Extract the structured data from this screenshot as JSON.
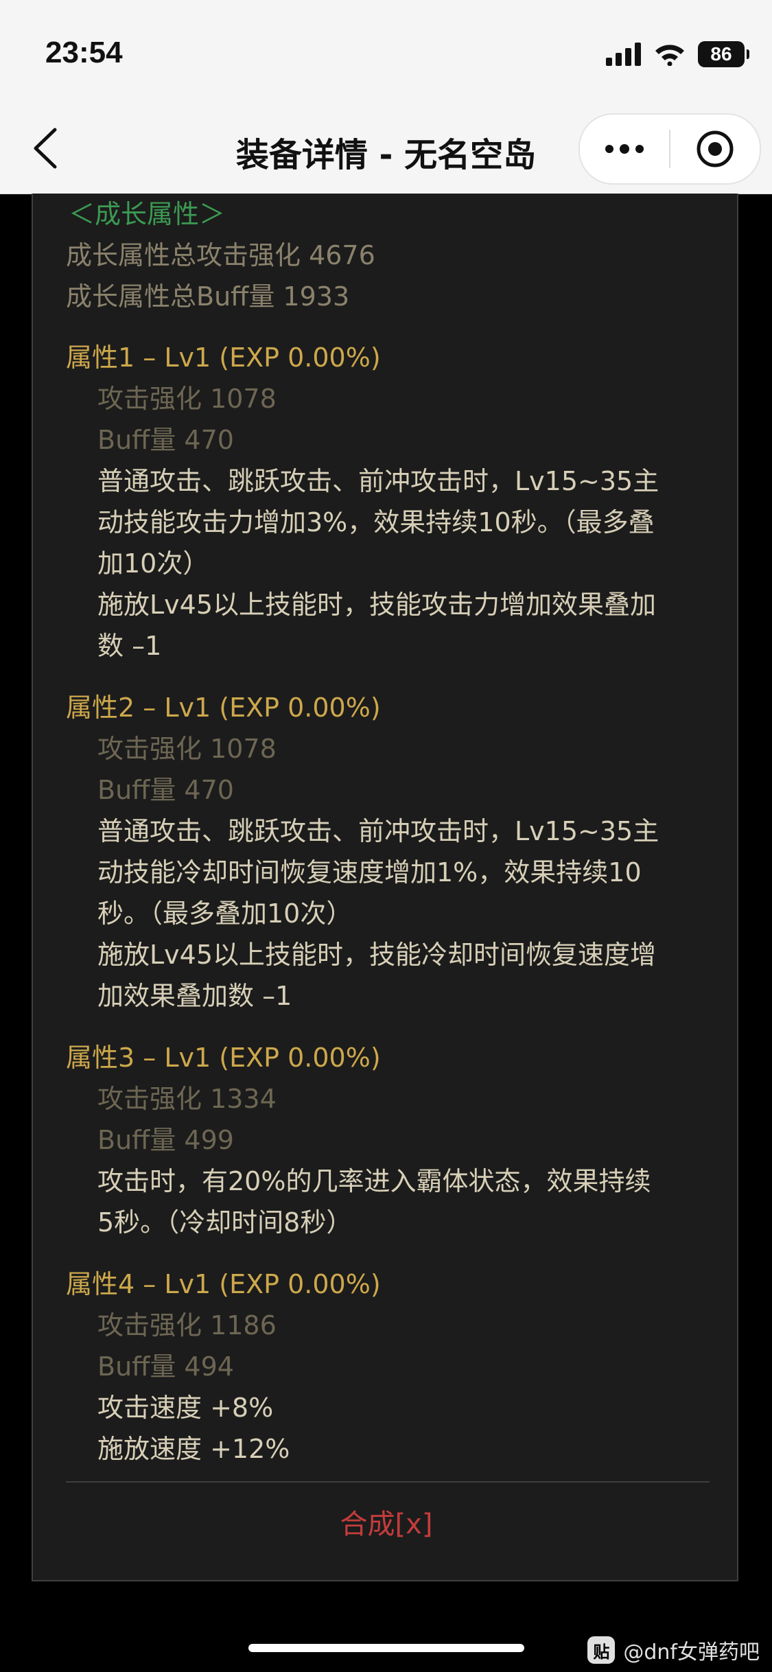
{
  "status_bar": {
    "time": "23:54",
    "battery": "86"
  },
  "nav": {
    "title": "装备详情 - 无名空岛"
  },
  "growth": {
    "header": "＜成长属性＞",
    "total_attack": "成长属性总攻击强化 4676",
    "total_buff": "成长属性总Buff量 1933"
  },
  "attributes": [
    {
      "title": "属性1 – Lv1 (EXP 0.00%)",
      "attack": "攻击强化   1078",
      "buff": "Buff量   470",
      "desc": [
        "普通攻击、跳跃攻击、前冲攻击时，Lv15~35主",
        "动技能攻击力增加3%，效果持续10秒。（最多叠",
        "加10次）",
        "施放Lv45以上技能时，技能攻击力增加效果叠加",
        "数 –1"
      ]
    },
    {
      "title": "属性2 – Lv1 (EXP 0.00%)",
      "attack": "攻击强化   1078",
      "buff": "Buff量   470",
      "desc": [
        "普通攻击、跳跃攻击、前冲攻击时，Lv15~35主",
        "动技能冷却时间恢复速度增加1%，效果持续10",
        "秒。（最多叠加10次）",
        "施放Lv45以上技能时，技能冷却时间恢复速度增",
        "加效果叠加数 –1"
      ]
    },
    {
      "title": "属性3 – Lv1 (EXP 0.00%)",
      "attack": "攻击强化   1334",
      "buff": "Buff量   499",
      "desc": [
        "攻击时，有20%的几率进入霸体状态，效果持续",
        "5秒。（冷却时间8秒）"
      ]
    },
    {
      "title": "属性4 – Lv1 (EXP 0.00%)",
      "attack": "攻击强化   1186",
      "buff": "Buff量   494",
      "desc": [
        "攻击速度 +8%",
        "施放速度 +12%"
      ]
    }
  ],
  "synth_link": "合成[x]",
  "watermark": {
    "badge": "贴",
    "text": "@dnf女弹药吧"
  },
  "icons": [
    "signal-icon",
    "wifi-icon",
    "battery-icon",
    "back-chevron-icon",
    "more-dots-icon",
    "close-target-icon"
  ]
}
